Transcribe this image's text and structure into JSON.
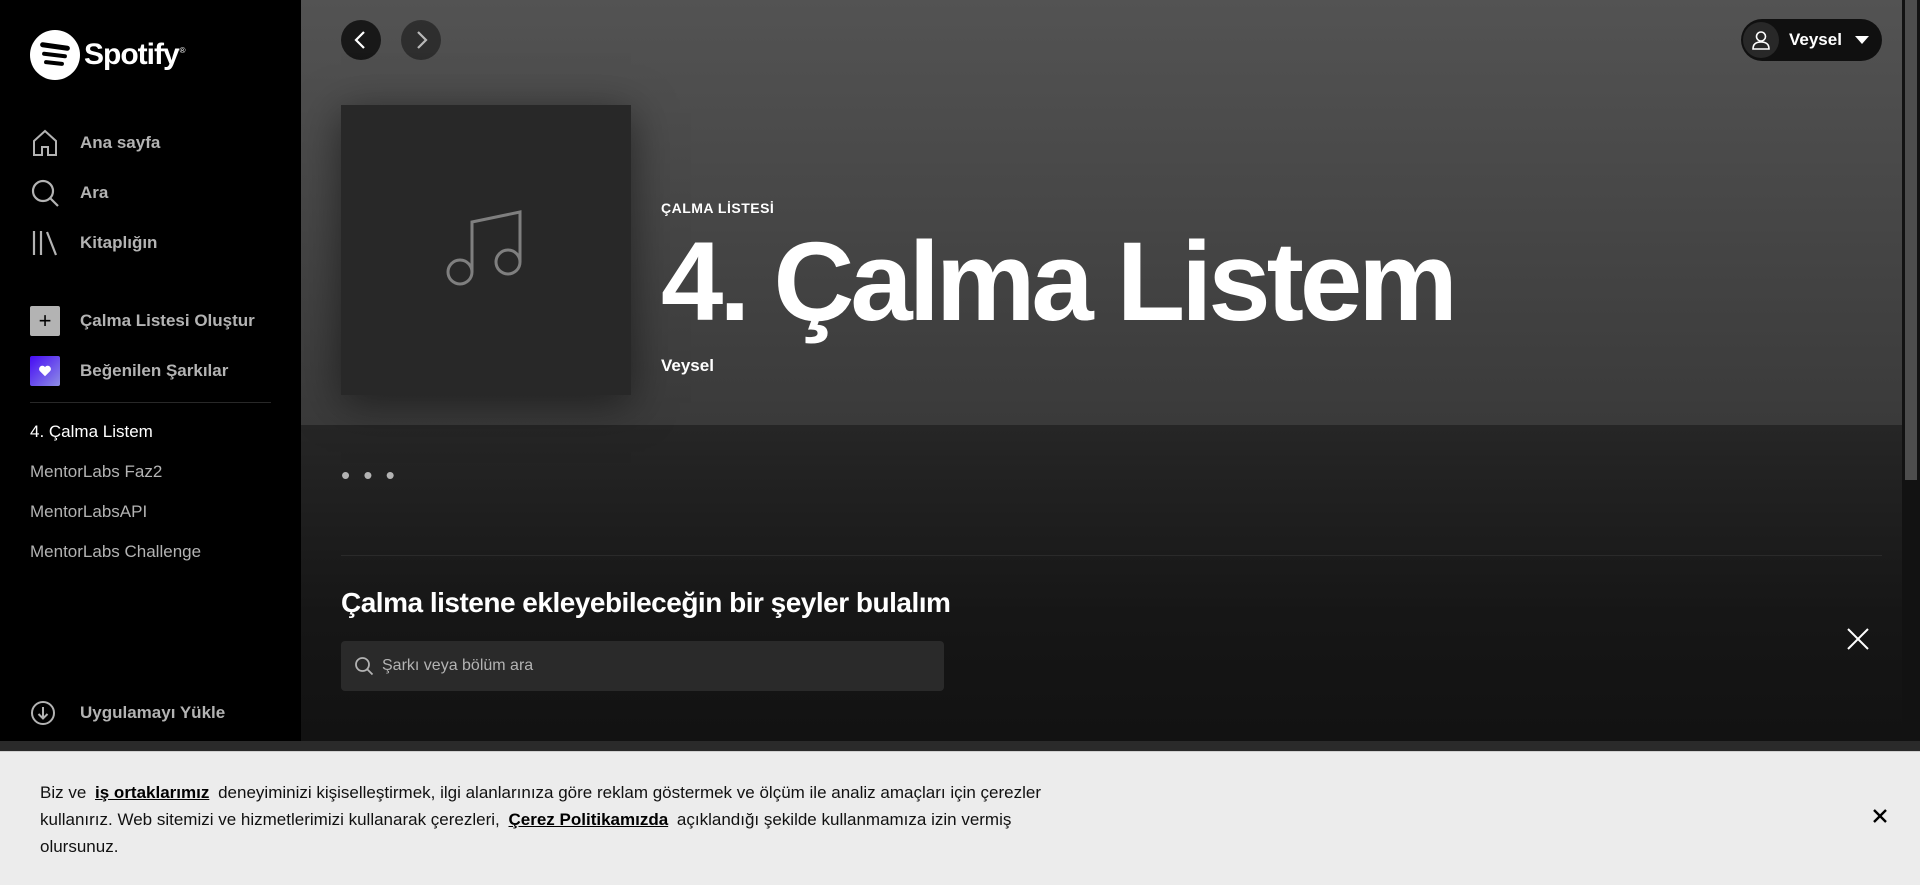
{
  "brand": {
    "name": "Spotify"
  },
  "sidebar": {
    "nav": [
      {
        "label": "Ana sayfa",
        "icon": "home-icon"
      },
      {
        "label": "Ara",
        "icon": "search-icon"
      },
      {
        "label": "Kitaplığın",
        "icon": "library-icon"
      }
    ],
    "actions": {
      "create_playlist": "Çalma Listesi Oluştur",
      "liked_songs": "Beğenilen Şarkılar"
    },
    "playlists": [
      "4. Çalma Listem",
      "MentorLabs Faz2",
      "MentorLabsAPI",
      "MentorLabs Challenge"
    ],
    "active_playlist_index": 0,
    "install_app": "Uygulamayı Yükle"
  },
  "header": {
    "user_name": "Veysel"
  },
  "playlist": {
    "type_label": "ÇALMA LİSTESİ",
    "title": "4. Çalma Listem",
    "owner": "Veysel",
    "more_label": "• • •"
  },
  "find_section": {
    "title": "Çalma listene ekleyebileceğin bir şeyler bulalım",
    "search_placeholder": "Şarkı veya bölüm ara"
  },
  "cookie": {
    "text_1": "Biz ve",
    "link_1": "iş ortaklarımız",
    "text_2": "deneyiminizi kişiselleştirmek, ilgi alanlarınıza göre reklam göstermek ve ölçüm ile analiz amaçları için çerezler kullanırız. Web sitemizi ve hizmetlerimizi kullanarak çerezleri,",
    "link_2": "Çerez Politikamızda",
    "text_3": "açıklandığı şekilde kullanmamıza izin vermiş olursunuz."
  },
  "colors": {
    "sidebar_bg": "#000000",
    "main_bg": "#121212",
    "hero_top": "#535353",
    "text_secondary": "#b3b3b3",
    "cookie_bg": "#ececec"
  }
}
